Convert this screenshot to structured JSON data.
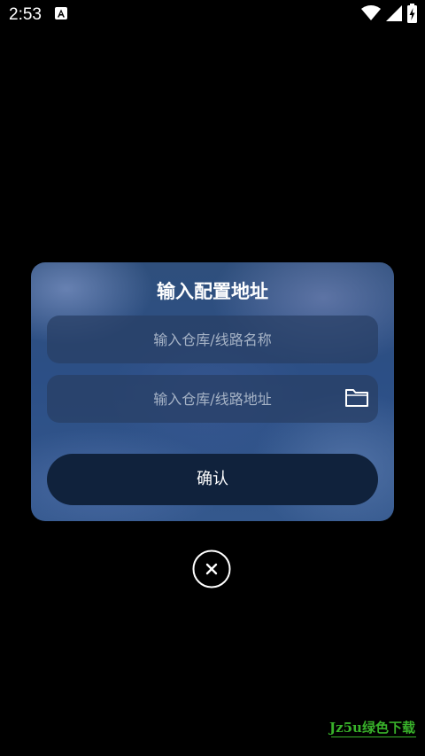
{
  "status_bar": {
    "time": "2:53",
    "notification_icon": "a-notification-icon",
    "wifi_icon": "wifi-icon",
    "signal_icon": "signal-icon",
    "battery_icon": "battery-charging-icon"
  },
  "dialog": {
    "title": "输入配置地址",
    "name_field": {
      "value": "",
      "placeholder": "输入仓库/线路名称"
    },
    "url_field": {
      "value": "",
      "placeholder": "输入仓库/线路地址",
      "icon": "folder-icon"
    },
    "confirm_label": "确认"
  },
  "close_button": {
    "icon": "close-icon"
  },
  "watermark": {
    "text": "Jz5u绿色下载"
  },
  "colors": {
    "background": "#000000",
    "confirm_button": "#10223c",
    "placeholder": "#a6b3c6",
    "watermark": "#38b12a"
  }
}
